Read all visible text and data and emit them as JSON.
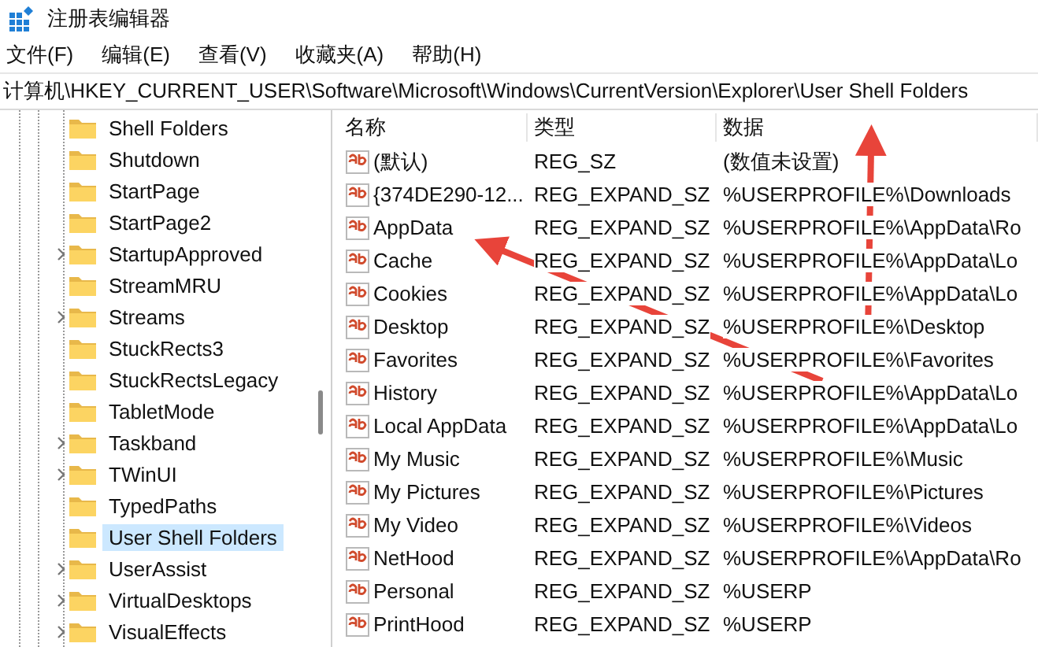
{
  "window": {
    "title": "注册表编辑器"
  },
  "menu": [
    "文件(F)",
    "编辑(E)",
    "查看(V)",
    "收藏夹(A)",
    "帮助(H)"
  ],
  "address": "计算机\\HKEY_CURRENT_USER\\Software\\Microsoft\\Windows\\CurrentVersion\\Explorer\\User Shell Folders",
  "tree": [
    {
      "label": "Shell Folders",
      "has_children": false,
      "selected": false
    },
    {
      "label": "Shutdown",
      "has_children": false,
      "selected": false
    },
    {
      "label": "StartPage",
      "has_children": false,
      "selected": false
    },
    {
      "label": "StartPage2",
      "has_children": false,
      "selected": false
    },
    {
      "label": "StartupApproved",
      "has_children": true,
      "selected": false
    },
    {
      "label": "StreamMRU",
      "has_children": false,
      "selected": false
    },
    {
      "label": "Streams",
      "has_children": true,
      "selected": false
    },
    {
      "label": "StuckRects3",
      "has_children": false,
      "selected": false
    },
    {
      "label": "StuckRectsLegacy",
      "has_children": false,
      "selected": false
    },
    {
      "label": "TabletMode",
      "has_children": false,
      "selected": false
    },
    {
      "label": "Taskband",
      "has_children": true,
      "selected": false
    },
    {
      "label": "TWinUI",
      "has_children": true,
      "selected": false
    },
    {
      "label": "TypedPaths",
      "has_children": false,
      "selected": false
    },
    {
      "label": "User Shell Folders",
      "has_children": false,
      "selected": true
    },
    {
      "label": "UserAssist",
      "has_children": true,
      "selected": false
    },
    {
      "label": "VirtualDesktops",
      "has_children": true,
      "selected": false
    },
    {
      "label": "VisualEffects",
      "has_children": true,
      "selected": false
    }
  ],
  "table": {
    "columns": [
      "名称",
      "类型",
      "数据"
    ],
    "rows": [
      {
        "name": "(默认)",
        "type": "REG_SZ",
        "data": "(数值未设置)"
      },
      {
        "name": "{374DE290-12...",
        "type": "REG_EXPAND_SZ",
        "data": "%USERPROFILE%\\Downloads"
      },
      {
        "name": "AppData",
        "type": "REG_EXPAND_SZ",
        "data": "%USERPROFILE%\\AppData\\Ro"
      },
      {
        "name": "Cache",
        "type": "REG_EXPAND_SZ",
        "data": "%USERPROFILE%\\AppData\\Lo"
      },
      {
        "name": "Cookies",
        "type": "REG_EXPAND_SZ",
        "data": "%USERPROFILE%\\AppData\\Lo"
      },
      {
        "name": "Desktop",
        "type": "REG_EXPAND_SZ",
        "data": "%USERPROFILE%\\Desktop"
      },
      {
        "name": "Favorites",
        "type": "REG_EXPAND_SZ",
        "data": "%USERPROFILE%\\Favorites"
      },
      {
        "name": "History",
        "type": "REG_EXPAND_SZ",
        "data": "%USERPROFILE%\\AppData\\Lo"
      },
      {
        "name": "Local AppData",
        "type": "REG_EXPAND_SZ",
        "data": "%USERPROFILE%\\AppData\\Lo"
      },
      {
        "name": "My Music",
        "type": "REG_EXPAND_SZ",
        "data": "%USERPROFILE%\\Music"
      },
      {
        "name": "My Pictures",
        "type": "REG_EXPAND_SZ",
        "data": "%USERPROFILE%\\Pictures"
      },
      {
        "name": "My Video",
        "type": "REG_EXPAND_SZ",
        "data": "%USERPROFILE%\\Videos"
      },
      {
        "name": "NetHood",
        "type": "REG_EXPAND_SZ",
        "data": "%USERPROFILE%\\AppData\\Ro"
      },
      {
        "name": "Personal",
        "type": "REG_EXPAND_SZ",
        "data": "%USERP"
      },
      {
        "name": "PrintHood",
        "type": "REG_EXPAND_SZ",
        "data": "%USERP"
      }
    ]
  }
}
